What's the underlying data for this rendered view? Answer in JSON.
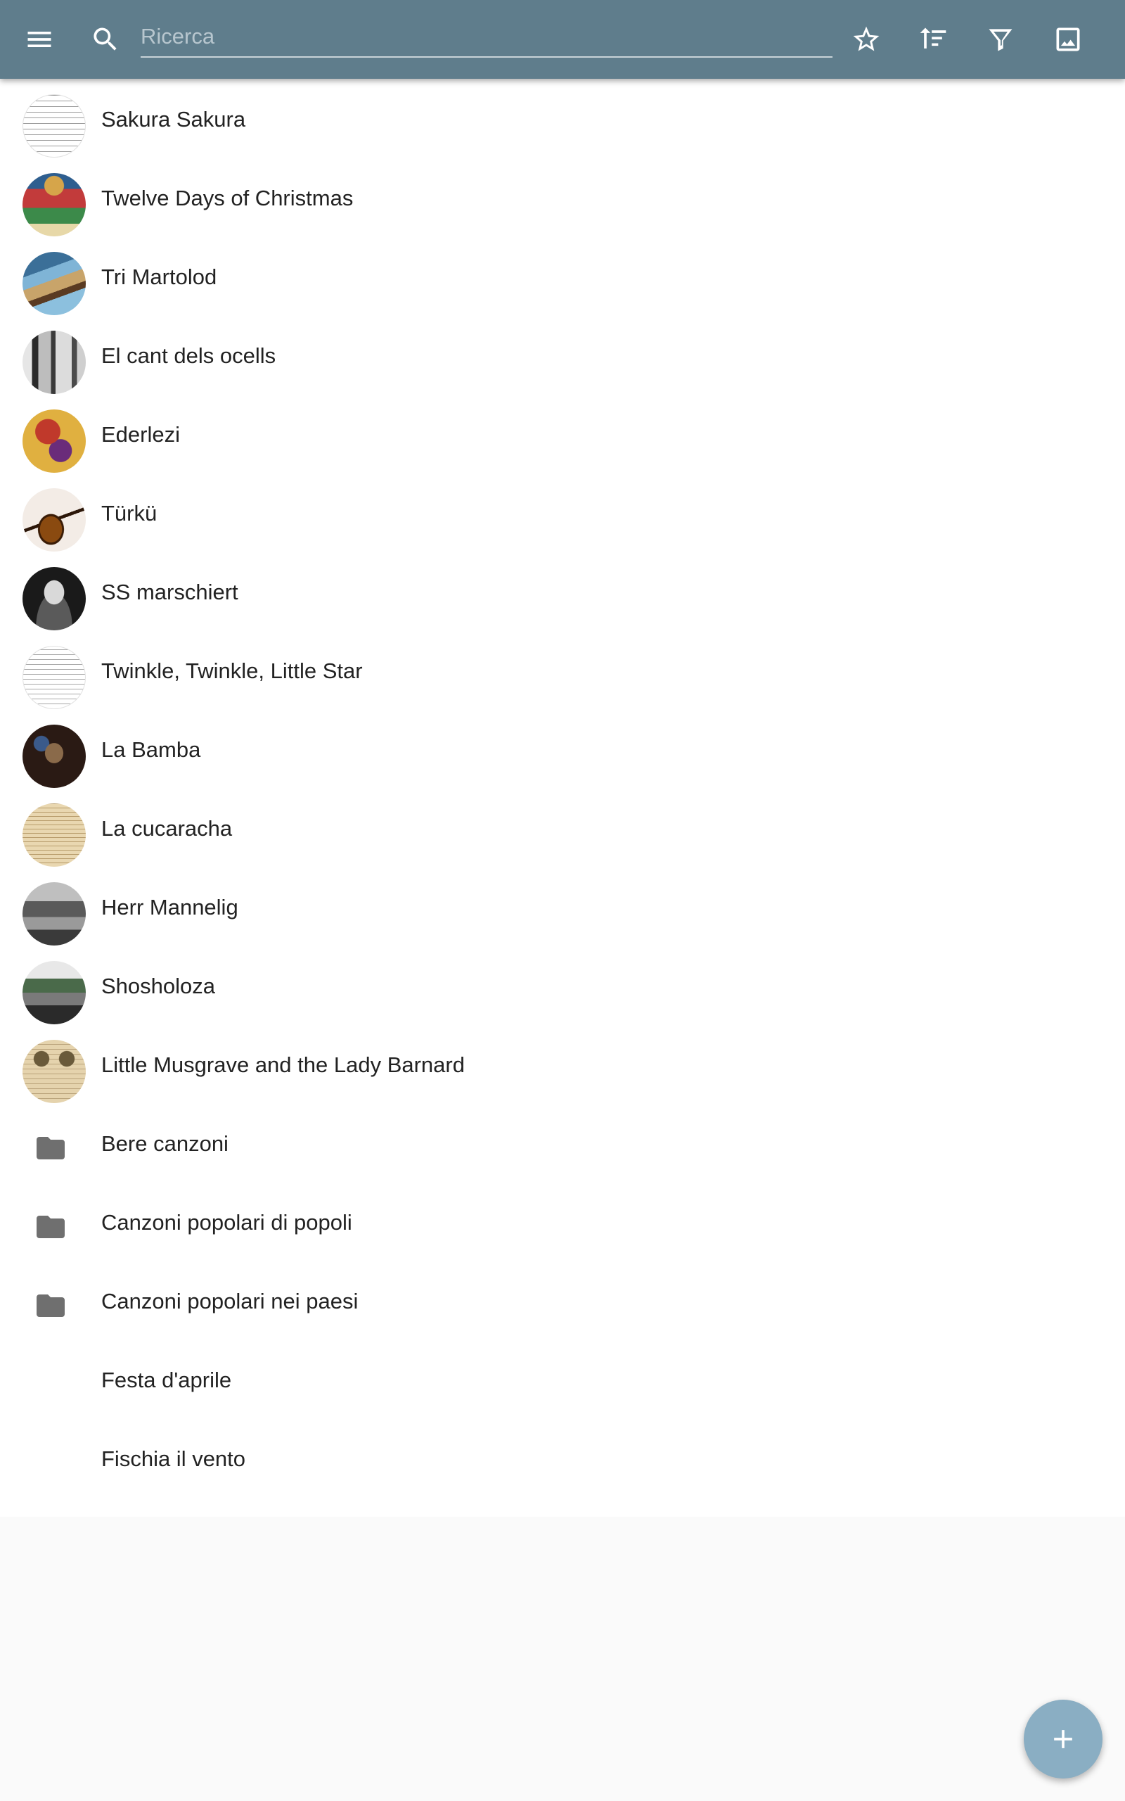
{
  "toolbar": {
    "menu_icon": "menu-icon",
    "search_icon": "search-icon",
    "search_placeholder": "Ricerca",
    "search_value": "",
    "actions": [
      "star-outline-icon",
      "sort-icon",
      "filter-icon",
      "image-icon"
    ],
    "background_color": "#5f7d8c"
  },
  "list": {
    "items": [
      {
        "label": "Sakura Sakura",
        "thumbnail": "sheet-music"
      },
      {
        "label": "Twelve Days of Christmas",
        "thumbnail": "illustration"
      },
      {
        "label": "Tri Martolod",
        "thumbnail": "photo"
      },
      {
        "label": "El cant dels ocells",
        "thumbnail": "photo"
      },
      {
        "label": "Ederlezi",
        "thumbnail": "icon-painting"
      },
      {
        "label": "Türkü",
        "thumbnail": "instrument"
      },
      {
        "label": "SS marschiert",
        "thumbnail": "portrait"
      },
      {
        "label": "Twinkle, Twinkle, Little Star",
        "thumbnail": "sheet-music"
      },
      {
        "label": "La Bamba",
        "thumbnail": "photo"
      },
      {
        "label": "La cucaracha",
        "thumbnail": "print"
      },
      {
        "label": "Herr Mannelig",
        "thumbnail": "engraving"
      },
      {
        "label": "Shosholoza",
        "thumbnail": "photo"
      },
      {
        "label": "Little Musgrave and the Lady Barnard",
        "thumbnail": "broadside"
      },
      {
        "label": "Bere canzoni",
        "icon": "folder-icon"
      },
      {
        "label": "Canzoni popolari di popoli",
        "icon": "folder-icon"
      },
      {
        "label": "Canzoni popolari nei paesi",
        "icon": "folder-icon"
      },
      {
        "label": "Festa d'aprile"
      },
      {
        "label": "Fischia il vento"
      }
    ]
  },
  "fab": {
    "icon": "plus-icon",
    "color": "#8aaec3"
  }
}
